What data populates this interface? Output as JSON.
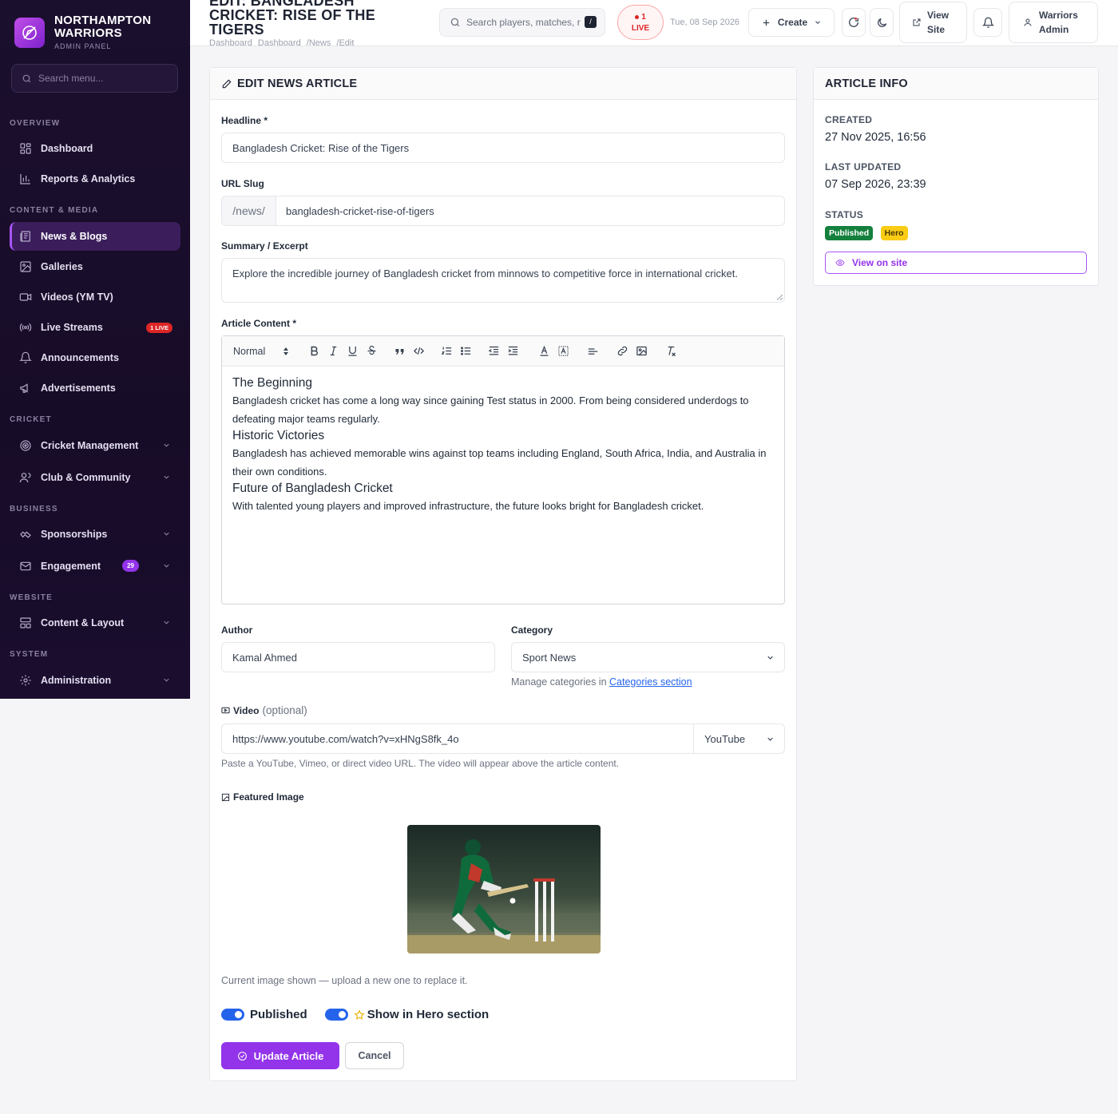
{
  "brand": {
    "name": "NORTHAMPTON WARRIORS",
    "subtitle": "ADMIN PANEL"
  },
  "sidebar": {
    "search_placeholder": "Search menu...",
    "sections": {
      "overview": "OVERVIEW",
      "content": "CONTENT & MEDIA",
      "cricket": "CRICKET",
      "business": "BUSINESS",
      "website": "WEBSITE",
      "system": "SYSTEM"
    },
    "items": {
      "dashboard": "Dashboard",
      "reports": "Reports & Analytics",
      "news": "News & Blogs",
      "galleries": "Galleries",
      "videos": "Videos (YM TV)",
      "live": "Live Streams",
      "live_badge": "1 LIVE",
      "announcements": "Announcements",
      "ads": "Advertisements",
      "cricket_mgmt": "Cricket Management",
      "club": "Club & Community",
      "sponsorships": "Sponsorships",
      "engagement": "Engagement",
      "engagement_badge": "29",
      "content_layout": "Content & Layout",
      "administration": "Administration"
    }
  },
  "header": {
    "title": "EDIT: BANGLADESH CRICKET: RISE OF THE TIGERS",
    "breadcrumbs": [
      "Dashboard",
      "Dashboard",
      "/News",
      "/Edit"
    ],
    "search_placeholder": "Search players, matches, r",
    "search_kbd": "/",
    "live_count": "1",
    "live_label": "LIVE",
    "date": "Tue, 08 Sep 2026",
    "create_label": "Create",
    "view_site_label": "View Site",
    "user_label": "Warriors Admin"
  },
  "form": {
    "heading": "EDIT NEWS ARTICLE",
    "headline_label": "Headline *",
    "headline_value": "Bangladesh Cricket: Rise of the Tigers",
    "slug_label": "URL Slug",
    "slug_prefix": "/news/",
    "slug_value": "bangladesh-cricket-rise-of-tigers",
    "summary_label": "Summary / Excerpt",
    "summary_value": "Explore the incredible journey of Bangladesh cricket from minnows to competitive force in international cricket.",
    "content_label": "Article Content *",
    "toolbar_style": "Normal",
    "content": {
      "h1": "The Beginning",
      "p1": "Bangladesh cricket has come a long way since gaining Test status in 2000. From being considered underdogs to defeating major teams regularly.",
      "h2": "Historic Victories",
      "p2": "Bangladesh has achieved memorable wins against top teams including England, South Africa, India, and Australia in their own conditions.",
      "h3": "Future of Bangladesh Cricket",
      "p3": "With talented young players and improved infrastructure, the future looks bright for Bangladesh cricket."
    },
    "author_label": "Author",
    "author_value": "Kamal Ahmed",
    "category_label": "Category",
    "category_value": "Sport News",
    "category_help": "Manage categories in",
    "category_link": "Categories section",
    "video_label": "Video",
    "video_optional": "(optional)",
    "video_value": "https://www.youtube.com/watch?v=xHNgS8fk_4o",
    "video_provider": "YouTube",
    "video_help": "Paste a YouTube, Vimeo, or direct video URL. The video will appear above the article content.",
    "image_label": "Featured Image",
    "image_help": "Current image shown — upload a new one to replace it.",
    "published_label": "Published",
    "hero_label": "Show in Hero section",
    "update_label": "Update Article",
    "cancel_label": "Cancel"
  },
  "info": {
    "heading": "ARTICLE INFO",
    "created_label": "CREATED",
    "created_value": "27 Nov 2025, 16:56",
    "updated_label": "LAST UPDATED",
    "updated_value": "07 Sep 2026, 23:39",
    "status_label": "STATUS",
    "status_published": "Published",
    "status_hero": "Hero",
    "view_label": "View on site"
  },
  "colors": {
    "accent": "#9333ea",
    "sidebar_bg": "#1b0f2e",
    "published": "#15803d",
    "hero": "#facc15",
    "toggle": "#2563eb"
  }
}
